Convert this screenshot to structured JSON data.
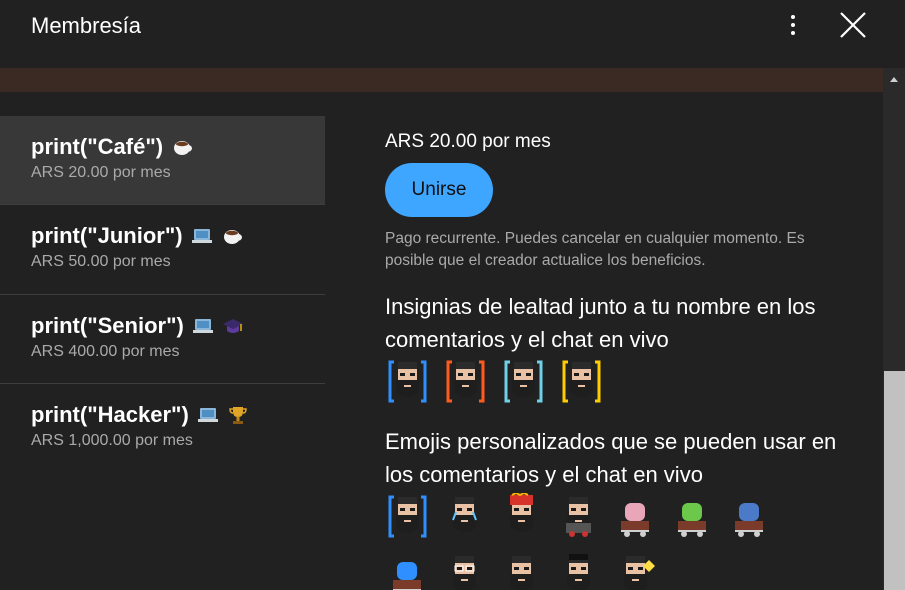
{
  "header": {
    "title": "Membresía",
    "more_icon": "more-vertical-icon",
    "close_icon": "close-icon"
  },
  "tiers": [
    {
      "name": "print(\"Café\")",
      "price": "ARS 20.00 por mes",
      "icons": [
        "coffee-cup-icon"
      ],
      "selected": true
    },
    {
      "name": "print(\"Junior\")",
      "price": "ARS 50.00 por mes",
      "icons": [
        "laptop-icon",
        "coffee-cup-icon"
      ]
    },
    {
      "name": "print(\"Senior\")",
      "price": "ARS 400.00 por mes",
      "icons": [
        "laptop-icon",
        "graduation-cap-icon"
      ]
    },
    {
      "name": "print(\"Hacker\")",
      "price": "ARS 1,000.00 por mes",
      "icons": [
        "laptop-icon",
        "trophy-icon"
      ]
    }
  ],
  "detail": {
    "price": "ARS 20.00 por mes",
    "join_label": "Unirse",
    "notice": "Pago recurrente. Puedes cancelar en cualquier momento. Es posible que el creador actualice los beneficios.",
    "perk_badges_title": "Insignias de lealtad junto a tu nombre en los comentarios y el chat en vivo",
    "perk_emojis_title": "Emojis personalizados que se pueden usar en los comentarios y el chat en vivo"
  },
  "colors": {
    "background": "#212121",
    "accent": "#3ea6ff",
    "selected": "#383838",
    "secondary_text": "#aaaaaa",
    "banner": "#3b2a24"
  }
}
